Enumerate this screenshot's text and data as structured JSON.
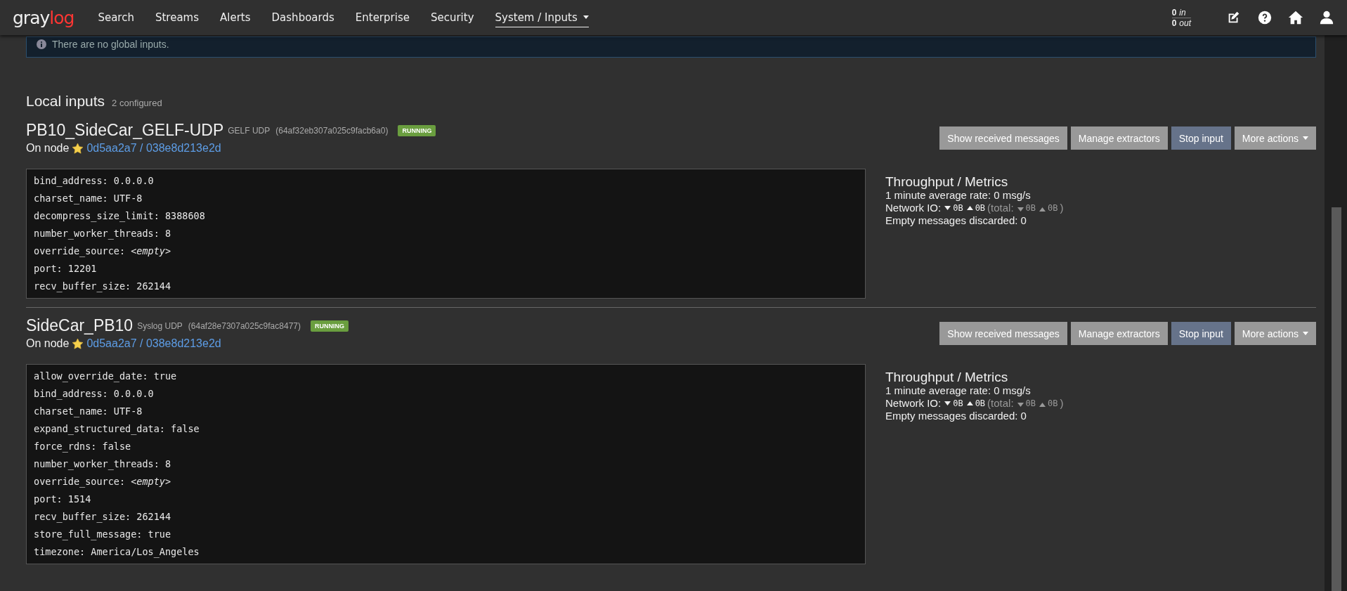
{
  "navbar": {
    "logo_left": "gray",
    "logo_right": "log",
    "items": [
      {
        "label": "Search",
        "selected": false,
        "dropdown": false
      },
      {
        "label": "Streams",
        "selected": false,
        "dropdown": false
      },
      {
        "label": "Alerts",
        "selected": false,
        "dropdown": false
      },
      {
        "label": "Dashboards",
        "selected": false,
        "dropdown": false
      },
      {
        "label": "Enterprise",
        "selected": false,
        "dropdown": false
      },
      {
        "label": "Security",
        "selected": false,
        "dropdown": false
      },
      {
        "label": "System / Inputs",
        "selected": true,
        "dropdown": true
      }
    ],
    "throughput": {
      "in_value": "0",
      "in_label": "in",
      "out_value": "0",
      "out_label": "out"
    }
  },
  "global_inputs_notice": "There are no global inputs.",
  "local_inputs": {
    "title": "Local inputs",
    "count": "2 configured",
    "inputs": [
      {
        "name": "PB10_SideCar_GELF-UDP",
        "type": "GELF UDP",
        "id": "(64af32eb307a025c9facb6a0)",
        "status": "RUNNING",
        "node_label": "On node",
        "node_link": "0d5aa2a7 / 038e8d213e2d",
        "buttons": [
          {
            "label": "Show received messages",
            "kind": "default"
          },
          {
            "label": "Manage extractors",
            "kind": "default"
          },
          {
            "label": "Stop input",
            "kind": "primary"
          },
          {
            "label": "More actions",
            "kind": "dropdown"
          }
        ],
        "config": [
          {
            "key": "bind_address:",
            "value": "0.0.0.0",
            "empty": false
          },
          {
            "key": "charset_name:",
            "value": "UTF-8",
            "empty": false
          },
          {
            "key": "decompress_size_limit:",
            "value": "8388608",
            "empty": false
          },
          {
            "key": "number_worker_threads:",
            "value": "8",
            "empty": false
          },
          {
            "key": "override_source:",
            "value": "<empty>",
            "empty": true
          },
          {
            "key": "port:",
            "value": "12201",
            "empty": false
          },
          {
            "key": "recv_buffer_size:",
            "value": "262144",
            "empty": false
          }
        ],
        "metrics": {
          "title": "Throughput / Metrics",
          "rate": "1 minute average rate: 0 msg/s",
          "network_label": "Network IO:",
          "rx": "0B",
          "tx": "0B",
          "total_label": "(total:",
          "total_rx": "0B",
          "total_tx": "0B",
          "total_close": ")",
          "discarded": "Empty messages discarded: 0"
        }
      },
      {
        "name": "SideCar_PB10",
        "type": "Syslog UDP",
        "id": "(64af28e7307a025c9fac8477)",
        "status": "RUNNING",
        "node_label": "On node",
        "node_link": "0d5aa2a7 / 038e8d213e2d",
        "buttons": [
          {
            "label": "Show received messages",
            "kind": "default"
          },
          {
            "label": "Manage extractors",
            "kind": "default"
          },
          {
            "label": "Stop input",
            "kind": "primary"
          },
          {
            "label": "More actions",
            "kind": "dropdown"
          }
        ],
        "config": [
          {
            "key": "allow_override_date:",
            "value": "true",
            "empty": false
          },
          {
            "key": "bind_address:",
            "value": "0.0.0.0",
            "empty": false
          },
          {
            "key": "charset_name:",
            "value": "UTF-8",
            "empty": false
          },
          {
            "key": "expand_structured_data:",
            "value": "false",
            "empty": false
          },
          {
            "key": "force_rdns:",
            "value": "false",
            "empty": false
          },
          {
            "key": "number_worker_threads:",
            "value": "8",
            "empty": false
          },
          {
            "key": "override_source:",
            "value": "<empty>",
            "empty": true
          },
          {
            "key": "port:",
            "value": "1514",
            "empty": false
          },
          {
            "key": "recv_buffer_size:",
            "value": "262144",
            "empty": false
          },
          {
            "key": "store_full_message:",
            "value": "true",
            "empty": false
          },
          {
            "key": "timezone:",
            "value": "America/Los_Angeles",
            "empty": false
          }
        ],
        "metrics": {
          "title": "Throughput / Metrics",
          "rate": "1 minute average rate: 0 msg/s",
          "network_label": "Network IO:",
          "rx": "0B",
          "tx": "0B",
          "total_label": "(total:",
          "total_rx": "0B",
          "total_tx": "0B",
          "total_close": ")",
          "discarded": "Empty messages discarded: 0"
        }
      }
    ]
  }
}
